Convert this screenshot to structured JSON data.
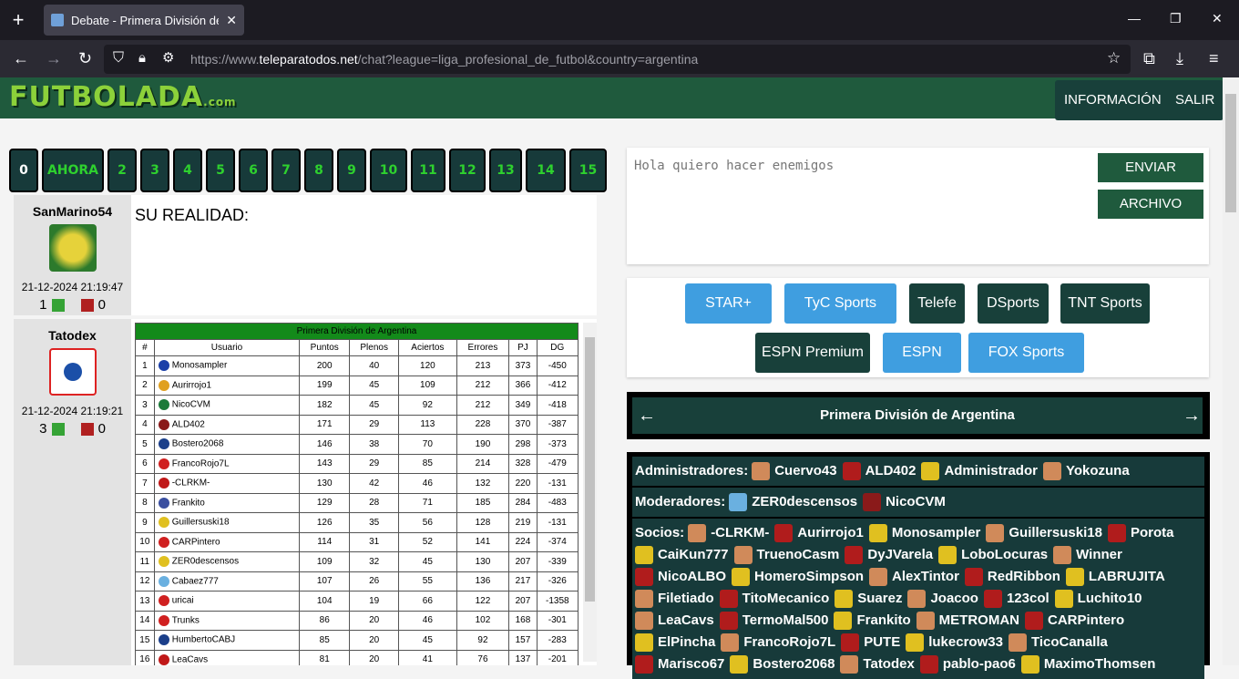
{
  "browser": {
    "tab_title": "Debate - Primera División de Ar",
    "url_prefix": "https://www.",
    "url_domain": "teleparatodos.net",
    "url_path": "/chat?league=liga_profesional_de_futbol&country=argentina"
  },
  "site": {
    "logo": "FUTBOLADA",
    "logo_suffix": ".com",
    "nav": [
      "INFORMACIÓN",
      "SALIR"
    ]
  },
  "rounds": [
    "0",
    "AHORA",
    "2",
    "3",
    "4",
    "5",
    "6",
    "7",
    "8",
    "9",
    "10",
    "11",
    "12",
    "13",
    "14",
    "15"
  ],
  "posts": [
    {
      "user": "SanMarino54",
      "date": "21-12-2024 21:19:47",
      "up": "1",
      "down": "0",
      "text": "SU REALIDAD:"
    },
    {
      "user": "Tatodex",
      "date": "21-12-2024 21:19:21",
      "up": "3",
      "down": "0"
    }
  ],
  "standings": {
    "caption": "Primera División de Argentina",
    "headers": [
      "#",
      "Usuario",
      "Puntos",
      "Plenos",
      "Aciertos",
      "Errores",
      "PJ",
      "DG"
    ],
    "rows": [
      [
        "1",
        "Monosampler",
        "200",
        "40",
        "120",
        "213",
        "373",
        "-450"
      ],
      [
        "2",
        "Aurirrojo1",
        "199",
        "45",
        "109",
        "212",
        "366",
        "-412"
      ],
      [
        "3",
        "NicoCVM",
        "182",
        "45",
        "92",
        "212",
        "349",
        "-418"
      ],
      [
        "4",
        "ALD402",
        "171",
        "29",
        "113",
        "228",
        "370",
        "-387"
      ],
      [
        "5",
        "Bostero2068",
        "146",
        "38",
        "70",
        "190",
        "298",
        "-373"
      ],
      [
        "6",
        "FrancoRojo7L",
        "143",
        "29",
        "85",
        "214",
        "328",
        "-479"
      ],
      [
        "7",
        "-CLRKM-",
        "130",
        "42",
        "46",
        "132",
        "220",
        "-131"
      ],
      [
        "8",
        "Frankito",
        "129",
        "28",
        "71",
        "185",
        "284",
        "-483"
      ],
      [
        "9",
        "Guillersuski18",
        "126",
        "35",
        "56",
        "128",
        "219",
        "-131"
      ],
      [
        "10",
        "CARPintero",
        "114",
        "31",
        "52",
        "141",
        "224",
        "-374"
      ],
      [
        "11",
        "ZER0descensos",
        "109",
        "32",
        "45",
        "130",
        "207",
        "-339"
      ],
      [
        "12",
        "Cabaez777",
        "107",
        "26",
        "55",
        "136",
        "217",
        "-326"
      ],
      [
        "13",
        "uricai",
        "104",
        "19",
        "66",
        "122",
        "207",
        "-1358"
      ],
      [
        "14",
        "Trunks",
        "86",
        "20",
        "46",
        "102",
        "168",
        "-301"
      ],
      [
        "15",
        "HumbertoCABJ",
        "85",
        "20",
        "45",
        "92",
        "157",
        "-283"
      ],
      [
        "16",
        "LeaCavs",
        "81",
        "20",
        "41",
        "76",
        "137",
        "-201"
      ]
    ]
  },
  "chat": {
    "placeholder": "Hola quiero hacer enemigos",
    "send": "ENVIAR",
    "file": "ARCHIVO"
  },
  "channels": [
    "STAR+",
    "TyC Sports",
    "Telefe",
    "DSports",
    "TNT Sports",
    "ESPN Premium",
    "ESPN",
    "FOX Sports"
  ],
  "league": "Primera División de Argentina",
  "members": {
    "admins_label": "Administradores:",
    "admins": [
      "Cuervo43",
      "ALD402",
      "Administrador",
      "Yokozuna"
    ],
    "mods_label": "Moderadores:",
    "mods": [
      "ZER0descensos",
      "NicoCVM"
    ],
    "socios_label": "Socios:",
    "socios": [
      "-CLRKM-",
      "Aurirrojo1",
      "Monosampler",
      "Guillersuski18",
      "Porota",
      "CaiKun777",
      "TruenoCasm",
      "DyJVarela",
      "LoboLocuras",
      "Winner",
      "NicoALBO",
      "HomeroSimpson",
      "AlexTintor",
      "RedRibbon",
      "LABRUJITA",
      "Filetiado",
      "TitoMecanico",
      "Suarez",
      "Joacoo",
      "123col",
      "Luchito10",
      "LeaCavs",
      "TermoMal500",
      "Frankito",
      "METROMAN",
      "CARPintero",
      "ElPincha",
      "FrancoRojo7L",
      "PUTE",
      "lukecrow33",
      "TicoCanalla",
      "Marisco67",
      "Bostero2068",
      "Tatodex",
      "pablo-pao6",
      "MaximoThomsen"
    ]
  }
}
